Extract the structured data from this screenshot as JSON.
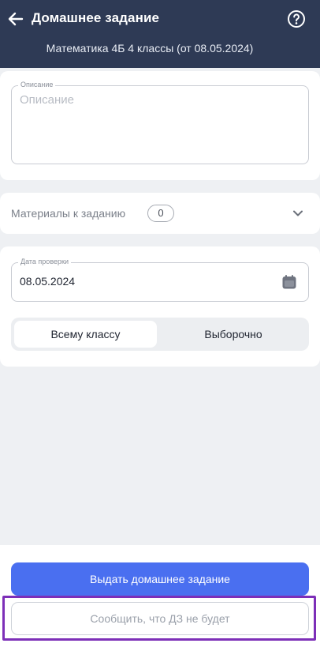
{
  "header": {
    "title": "Домашнее задание",
    "subtitle": "Математика 4Б 4 классы (от 08.05.2024)",
    "back_icon": "arrow-left-icon",
    "help_icon": "question-circle-icon",
    "background_color": "#2e3a55"
  },
  "description": {
    "label": "Описание",
    "placeholder": "Описание",
    "value": ""
  },
  "materials": {
    "label": "Материалы к заданию",
    "count": "0",
    "expand_icon": "chevron-down-icon"
  },
  "check_date": {
    "label": "Дата проверки",
    "value": "08.05.2024",
    "icon": "calendar-icon"
  },
  "audience": {
    "options": [
      "Всему классу",
      "Выборочно"
    ],
    "selected": "Всему классу"
  },
  "actions": {
    "primary_label": "Выдать домашнее задание",
    "secondary_label": "Сообщить, что ДЗ не будет",
    "primary_color": "#4a6ff0",
    "highlight_color": "#7d2fb8"
  }
}
